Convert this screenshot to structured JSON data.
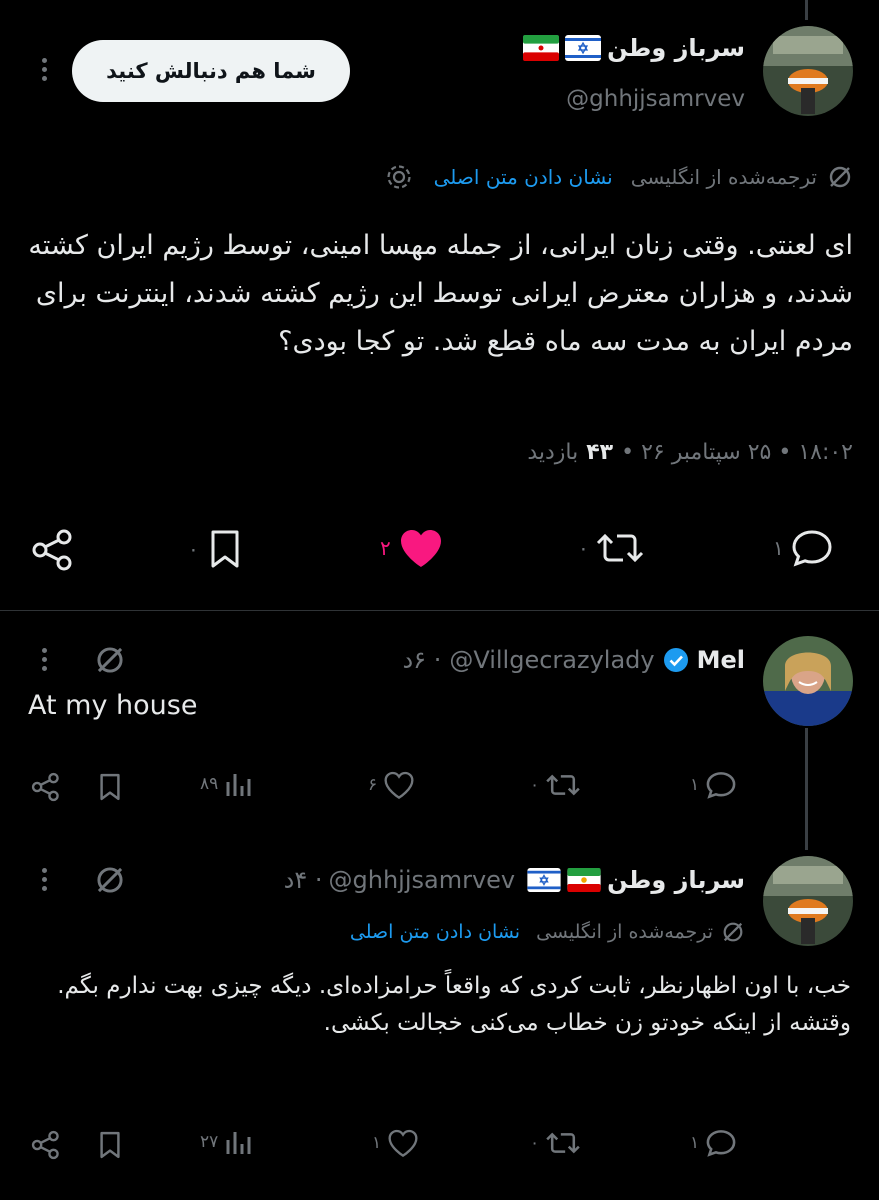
{
  "colors": {
    "background": "#000000",
    "text": "#e7e9ea",
    "muted": "#71767b",
    "link": "#1d9bf0",
    "like": "#f91880",
    "verified": "#1d9bf0"
  },
  "main_tweet": {
    "display_name": "سرباز وطن",
    "flags": [
      "israel-flag-icon",
      "iran-flag-icon"
    ],
    "handle": "@ghhjjsamrvev",
    "follow_label": "شما هم دنبالش کنید",
    "translated_label": "ترجمه‌شده از انگلیسی",
    "show_original_label": "نشان دادن متن اصلی",
    "body": "ای لعنتی. وقتی زنان ایرانی، از جمله مهسا امینی، توسط رژیم ایران کشته شدند، و هزاران معترض ایرانی توسط این رژیم کشته شدند، اینترنت برای مردم ایران به مدت سه ماه قطع شد. تو کجا بودی؟",
    "meta_time": "۱۸:۰۲ • ۲۵ سپتامبر ۲۶ •",
    "views_count": "۴۳",
    "views_label": "بازدید",
    "actions": {
      "replies": "۱",
      "retweets": "۰",
      "likes": "۲",
      "bookmarks": "۰"
    }
  },
  "reply1": {
    "display_name": "Mel",
    "handle": "@Villgecrazylady",
    "time": "· ۶د",
    "body": "At my house",
    "actions": {
      "replies": "۱",
      "retweets": "۰",
      "likes": "۶",
      "views": "۸۹"
    }
  },
  "reply2": {
    "display_name": "سرباز وطن",
    "flags": [
      "iran-lion-flag-icon",
      "israel-flag-icon"
    ],
    "handle": "@ghhjjsamrvev",
    "time": "· ۴د",
    "translated_label": "ترجمه‌شده از انگلیسی",
    "show_original_label": "نشان دادن متن اصلی",
    "body": "خب، با اون اظهارنظر، ثابت کردی که واقعاً حرامزاده‌ای. دیگه چیزی بهت ندارم بگم. وقتشه از اینکه خودتو زن خطاب می‌کنی خجالت بکشی.",
    "actions": {
      "replies": "۱",
      "retweets": "۰",
      "likes": "۱",
      "views": "۲۷"
    }
  }
}
